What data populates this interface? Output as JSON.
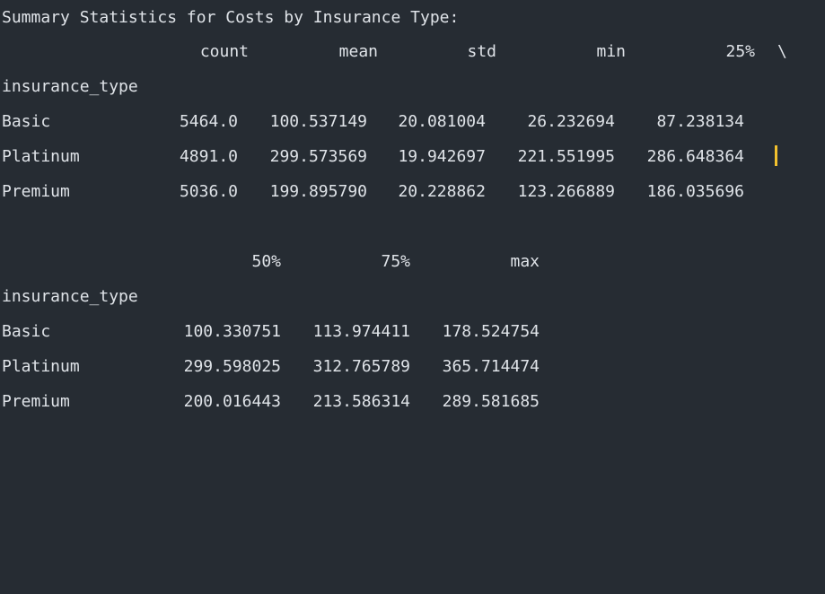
{
  "console": {
    "title_line": "Summary Statistics for Costs by Insurance Type:",
    "index_name": "insurance_type",
    "line_continuation": "\\",
    "block1": {
      "headers": [
        "count",
        "mean",
        "std",
        "min",
        "25%"
      ],
      "rows": [
        {
          "label": "Basic",
          "values": [
            "5464.0",
            "100.537149",
            "20.081004",
            "26.232694",
            "87.238134"
          ]
        },
        {
          "label": "Platinum",
          "values": [
            "4891.0",
            "299.573569",
            "19.942697",
            "221.551995",
            "286.648364"
          ]
        },
        {
          "label": "Premium",
          "values": [
            "5036.0",
            "199.895790",
            "20.228862",
            "123.266889",
            "186.035696"
          ]
        }
      ]
    },
    "block2": {
      "headers": [
        "50%",
        "75%",
        "max"
      ],
      "rows": [
        {
          "label": "Basic",
          "values": [
            "100.330751",
            "113.974411",
            "178.524754"
          ]
        },
        {
          "label": "Platinum",
          "values": [
            "299.598025",
            "312.765789",
            "365.714474"
          ]
        },
        {
          "label": "Premium",
          "values": [
            "200.016443",
            "213.586314",
            "289.581685"
          ]
        }
      ]
    },
    "colors": {
      "background": "#262c33",
      "text": "#dfe3e8",
      "caret": "#f2c12e"
    }
  }
}
